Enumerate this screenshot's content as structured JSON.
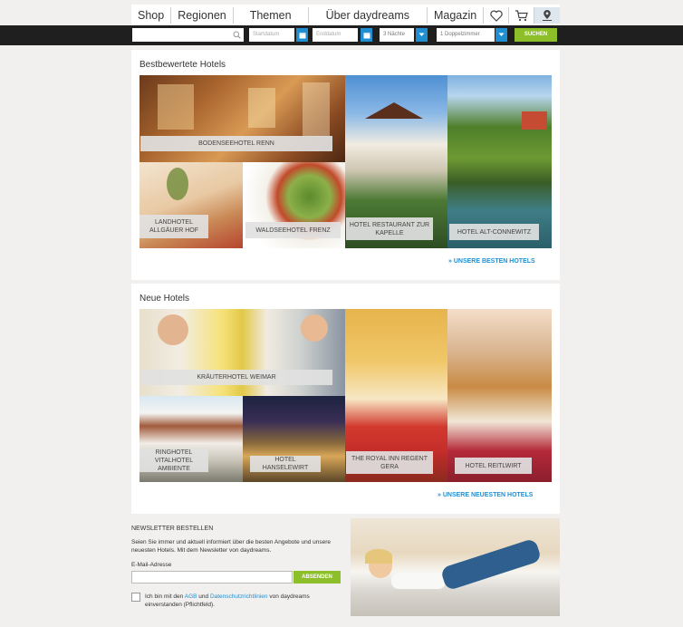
{
  "nav": {
    "items": [
      "Shop",
      "Regionen",
      "Themen",
      "Über daydreams",
      "Magazin"
    ],
    "icons": [
      "heart-icon",
      "cart-icon",
      "map-pin-icon"
    ]
  },
  "search": {
    "query_placeholder": "",
    "arrival_placeholder": "Startdatum",
    "departure_placeholder": "Enddatum",
    "nights": "3 Nächte",
    "room": "1 Doppelzimmer",
    "submit": "SUCHEN"
  },
  "best": {
    "title": "Bestbewertete Hotels",
    "hotels": [
      "BODENSEEHOTEL RENN",
      "LANDHOTEL ALLGÄUER HOF",
      "WALDSEEHOTEL FRENZ",
      "HOTEL RESTAURANT ZUR KAPELLE",
      "HOTEL ALT-CONNEWITZ"
    ],
    "more": "» UNSERE BESTEN HOTELS"
  },
  "new": {
    "title": "Neue Hotels",
    "hotels": [
      "KRÄUTERHOTEL WEIMAR",
      "RINGHOTEL VITALHOTEL AMBIENTE",
      "HOTEL HANSELEWIRT",
      "THE ROYAL INN REGENT GERA",
      "HOTEL REITLWIRT"
    ],
    "more": "» UNSERE NEUESTEN HOTELS"
  },
  "newsletter": {
    "title": "NEWSLETTER BESTELLEN",
    "text": "Seien Sie immer und aktuell informiert über die besten Angebote und unsere neuesten Hotels. Mit dem Newsletter von daydreams.",
    "email_label": "E-Mail-Adresse",
    "email_placeholder": "",
    "submit": "ABSENDEN",
    "consent_prefix": "Ich bin mit den ",
    "agb": "AGB",
    "consent_mid": " und ",
    "privacy": "Datenschutzrichtlinien",
    "consent_suffix": " von daydreams einverstanden (Pflichtfeld)."
  },
  "colors": {
    "accent": "#1f8fd2",
    "submit_green": "#8cbf2a",
    "bar": "#1f1f1f"
  }
}
